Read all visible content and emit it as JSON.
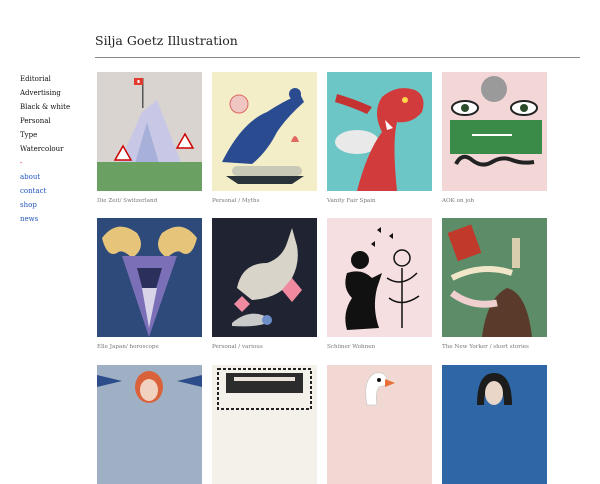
{
  "site": {
    "title": "Silja Goetz Illustration"
  },
  "nav": [
    {
      "label": "Editorial",
      "type": "category"
    },
    {
      "label": "Advertising",
      "type": "category"
    },
    {
      "label": "Black & white",
      "type": "category"
    },
    {
      "label": "Personal",
      "type": "category"
    },
    {
      "label": "Type",
      "type": "category"
    },
    {
      "label": "Watercolour",
      "type": "category"
    },
    {
      "label": "-",
      "type": "separator"
    },
    {
      "label": "about",
      "type": "link"
    },
    {
      "label": "contact",
      "type": "link"
    },
    {
      "label": "shop",
      "type": "link"
    },
    {
      "label": "news",
      "type": "link"
    }
  ],
  "gallery": [
    {
      "caption": "Die Zeit/ Switzerland",
      "art": "mountain-flag"
    },
    {
      "caption": "Personal / Myths",
      "art": "figure-sun"
    },
    {
      "caption": "Vanity Fair Spain",
      "art": "red-dragon"
    },
    {
      "caption": "AOK on job",
      "art": "green-face-sign"
    },
    {
      "caption": "Elle Japan/ horoscope",
      "art": "ram-head"
    },
    {
      "caption": "Personal / various",
      "art": "hare-snail"
    },
    {
      "caption": "Schöner Wohnen",
      "art": "girl-silhouette"
    },
    {
      "caption": "The New Yorker / short stories",
      "art": "woman-books"
    },
    {
      "caption": "",
      "art": "redhead-portrait"
    },
    {
      "caption": "",
      "art": "vintage-stamp"
    },
    {
      "caption": "",
      "art": "swan"
    },
    {
      "caption": "",
      "art": "bob-hair-woman"
    }
  ]
}
